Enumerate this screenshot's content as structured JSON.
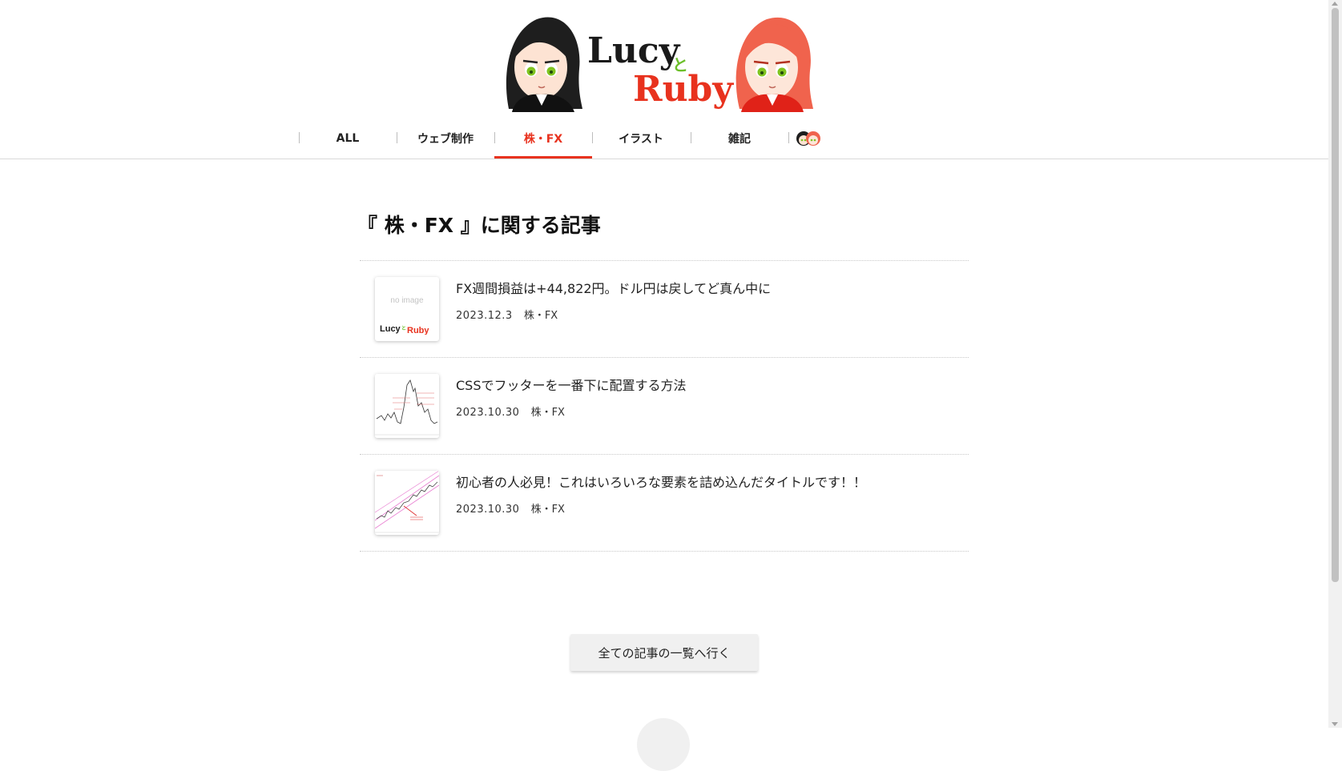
{
  "site": {
    "logo_line1": "Lucy",
    "logo_and": "と",
    "logo_line2": "Ruby"
  },
  "nav": {
    "items": [
      {
        "label": "ALL",
        "active": false
      },
      {
        "label": "ウェブ制作",
        "active": false
      },
      {
        "label": "株・FX",
        "active": true
      },
      {
        "label": "イラスト",
        "active": false
      },
      {
        "label": "雑記",
        "active": false
      }
    ],
    "active_color": "#e8321e"
  },
  "main": {
    "section_title": "『 株・FX 』に関する記事",
    "posts": [
      {
        "title": "FX週間損益は+44,822円。ドル円は戻してど真ん中に",
        "date": "2023.12.3",
        "category": "株・FX",
        "thumb": "no-image",
        "thumb_text": "no image",
        "thumb_logo": "Lucy と Ruby"
      },
      {
        "title": "CSSでフッターを一番下に配置する方法",
        "date": "2023.10.30",
        "category": "株・FX",
        "thumb": "chart-volatile"
      },
      {
        "title": "初心者の人必見！これはいろいろな要素を詰め込んだタイトルです！！",
        "date": "2023.10.30",
        "category": "株・FX",
        "thumb": "chart-channel"
      }
    ],
    "all_button_label": "全ての記事の一覧へ行く"
  },
  "icons": {
    "logo": "lucy-and-ruby-logo",
    "nav_avatar": "lucy-ruby-avatar-icon",
    "scroll_top": "scroll-top-button"
  }
}
